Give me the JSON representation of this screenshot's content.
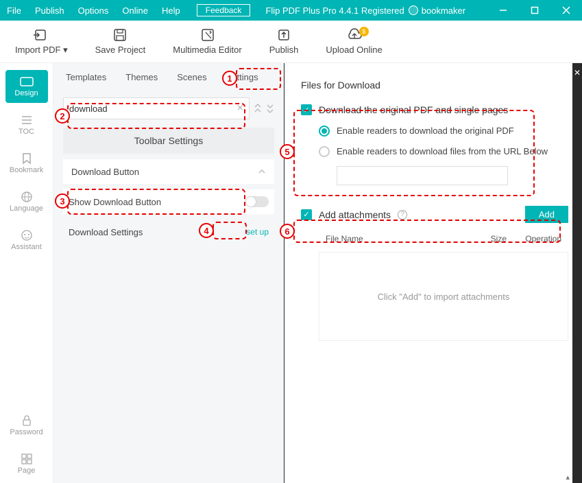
{
  "titlebar": {
    "menus": [
      "File",
      "Publish",
      "Options",
      "Online",
      "Help"
    ],
    "feedback": "Feedback",
    "title": "Flip PDF Plus Pro 4.4.1 Registered",
    "user": "bookmaker"
  },
  "toolbar": {
    "import": "Import PDF ▾",
    "save": "Save Project",
    "multimedia": "Multimedia Editor",
    "publish": "Publish",
    "upload": "Upload Online"
  },
  "leftbar": {
    "design": "Design",
    "toc": "TOC",
    "bookmark": "Bookmark",
    "language": "Language",
    "assistant": "Assistant",
    "password": "Password",
    "page": "Page"
  },
  "tabs": {
    "templates": "Templates",
    "themes": "Themes",
    "scenes": "Scenes",
    "settings": "Settings"
  },
  "settings": {
    "search_value": "download",
    "section": "Toolbar Settings",
    "subsection": "Download Button",
    "row1": "Show Download Button",
    "row2": "Download Settings",
    "setup": "set up"
  },
  "right": {
    "title": "Files for Download",
    "dl_orig": "Download the original PDF and single pages",
    "radio1": "Enable readers to download the original PDF",
    "radio2": "Enable readers to download files from the URL Below",
    "add_attach": "Add attachments",
    "add_btn": "Add",
    "col_file": "File Name",
    "col_size": "Size",
    "col_op": "Operation",
    "empty": "Click \"Add\" to import attachments"
  },
  "annotations": [
    "1",
    "2",
    "3",
    "4",
    "5",
    "6"
  ]
}
